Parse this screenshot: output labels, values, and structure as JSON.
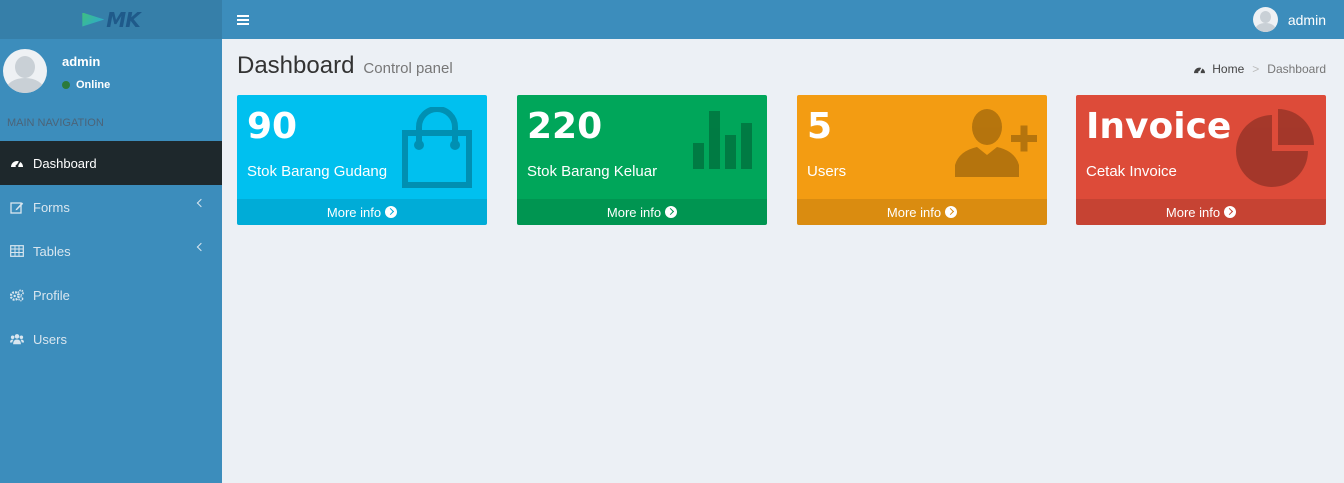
{
  "header": {
    "logo_text": "MK",
    "user_name": "admin"
  },
  "sidebar": {
    "user_name": "admin",
    "status": "Online",
    "nav_header": "MAIN NAVIGATION",
    "items": [
      {
        "label": "Dashboard",
        "icon": "dashboard-icon"
      },
      {
        "label": "Forms",
        "icon": "edit-icon"
      },
      {
        "label": "Tables",
        "icon": "table-icon"
      },
      {
        "label": "Profile",
        "icon": "gears-icon"
      },
      {
        "label": "Users",
        "icon": "users-icon"
      }
    ]
  },
  "content": {
    "title": "Dashboard",
    "subtitle": "Control panel",
    "breadcrumb": {
      "home": "Home",
      "current": "Dashboard"
    }
  },
  "boxes": [
    {
      "value": "90",
      "label": "Stok Barang Gudang",
      "footer": "More info",
      "color": "#00c0ef",
      "footer_color": "#00acd7",
      "icon": "shopping-bag-icon"
    },
    {
      "value": "220",
      "label": "Stok Barang Keluar",
      "footer": "More info",
      "color": "#00a65a",
      "footer_color": "#009551",
      "icon": "bar-chart-icon"
    },
    {
      "value": "5",
      "label": "Users",
      "footer": "More info",
      "color": "#f39c12",
      "footer_color": "#da8c10",
      "icon": "user-plus-icon"
    },
    {
      "value": "Invoice",
      "label": "Cetak Invoice",
      "footer": "More info",
      "color": "#dd4b39",
      "footer_color": "#c64333",
      "icon": "pie-chart-icon"
    }
  ]
}
